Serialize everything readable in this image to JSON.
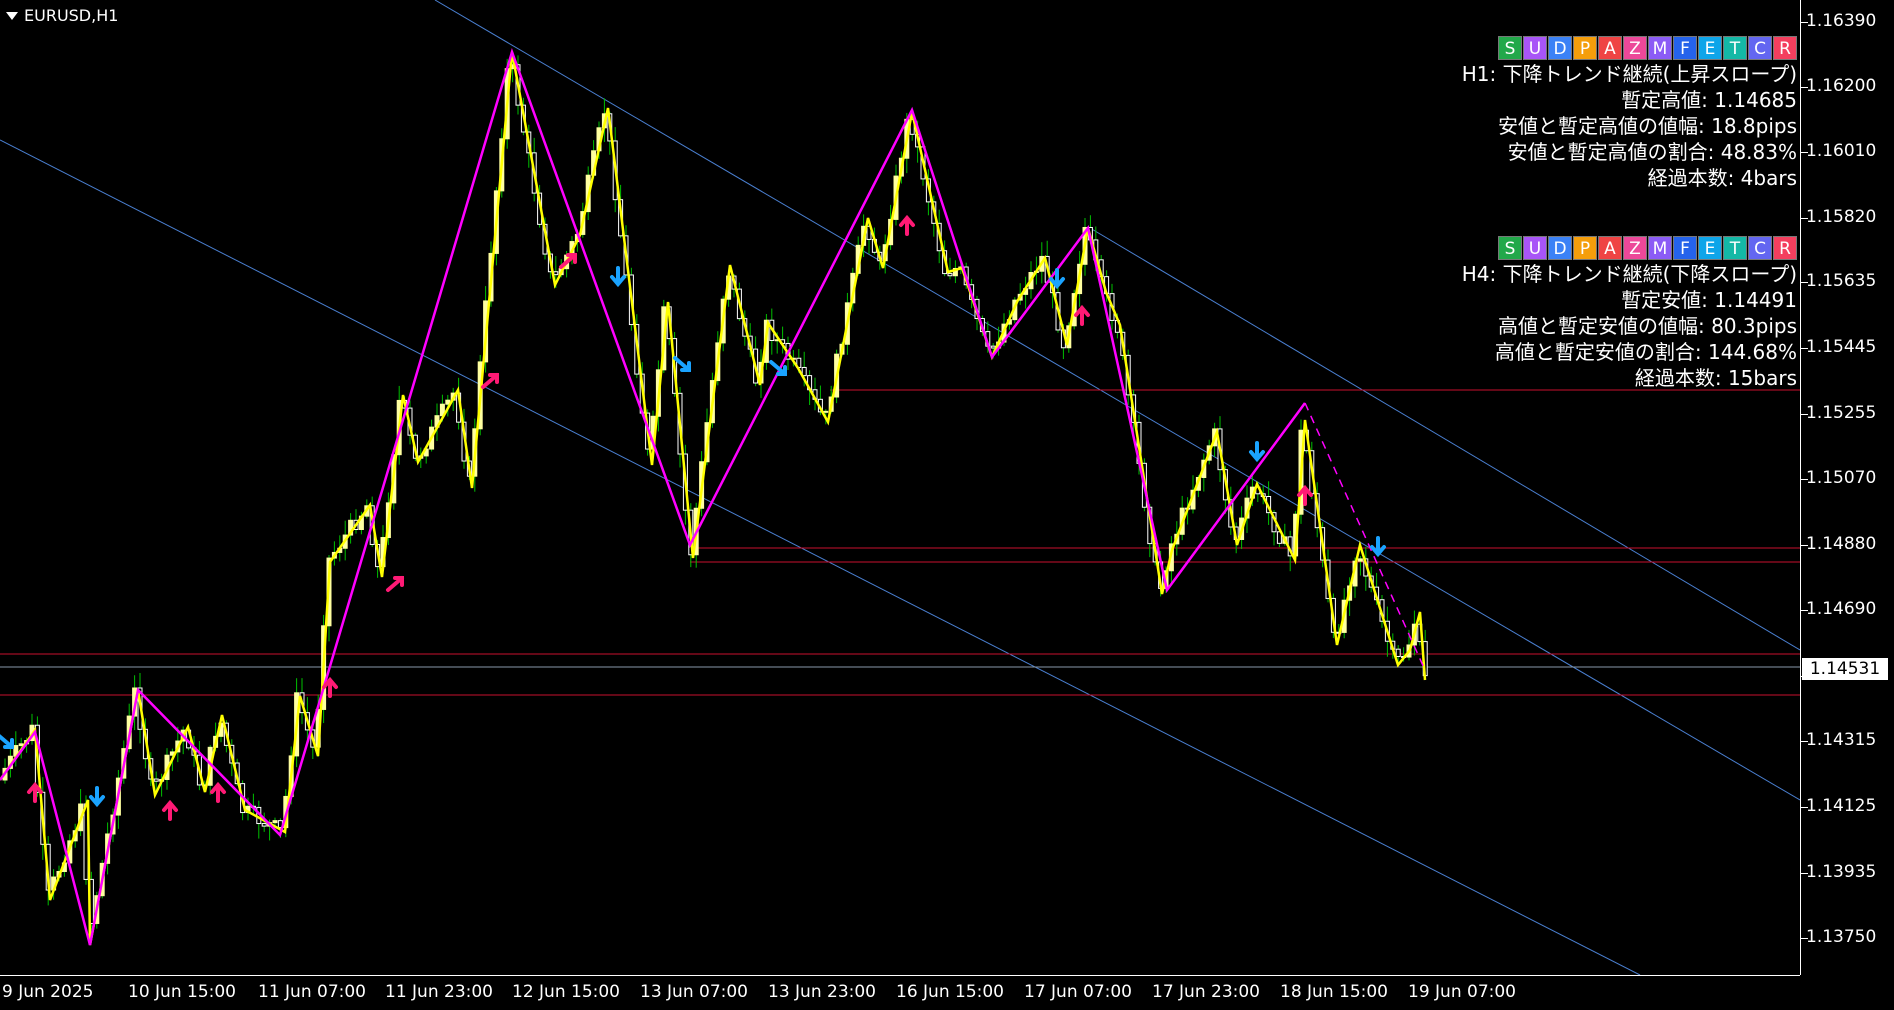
{
  "symbol_label": "EURUSD,H1",
  "panels": [
    {
      "buttons": [
        {
          "label": "S",
          "bg": "#22a84a"
        },
        {
          "label": "U",
          "bg": "#a855f7"
        },
        {
          "label": "D",
          "bg": "#3b82f6"
        },
        {
          "label": "P",
          "bg": "#f59e0b"
        },
        {
          "label": "A",
          "bg": "#ef4444"
        },
        {
          "label": "Z",
          "bg": "#ec4899"
        },
        {
          "label": "M",
          "bg": "#8b5cf6"
        },
        {
          "label": "F",
          "bg": "#2563eb"
        },
        {
          "label": "E",
          "bg": "#0ea5e9"
        },
        {
          "label": "T",
          "bg": "#14b8a6"
        },
        {
          "label": "C",
          "bg": "#6366f1"
        },
        {
          "label": "R",
          "bg": "#f43f5e"
        }
      ],
      "lines": [
        "H1: 下降トレンド継続(上昇スロープ)",
        "暫定高値: 1.14685",
        "安値と暫定高値の値幅: 18.8pips",
        "安値と暫定高値の割合: 48.83%",
        "経過本数: 4bars"
      ]
    },
    {
      "buttons": [
        {
          "label": "S",
          "bg": "#22a84a"
        },
        {
          "label": "U",
          "bg": "#a855f7"
        },
        {
          "label": "D",
          "bg": "#3b82f6"
        },
        {
          "label": "P",
          "bg": "#f59e0b"
        },
        {
          "label": "A",
          "bg": "#ef4444"
        },
        {
          "label": "Z",
          "bg": "#ec4899"
        },
        {
          "label": "M",
          "bg": "#8b5cf6"
        },
        {
          "label": "F",
          "bg": "#2563eb"
        },
        {
          "label": "E",
          "bg": "#0ea5e9"
        },
        {
          "label": "T",
          "bg": "#14b8a6"
        },
        {
          "label": "C",
          "bg": "#6366f1"
        },
        {
          "label": "R",
          "bg": "#f43f5e"
        }
      ],
      "lines": [
        "H4: 下降トレンド継続(下降スロープ)",
        "暫定安値: 1.14491",
        "高値と暫定安値の値幅: 80.3pips",
        "高値と暫定安値の割合: 144.68%",
        "経過本数: 15bars"
      ]
    }
  ],
  "price_ticks": [
    "1.16390",
    "1.16200",
    "1.16010",
    "1.15820",
    "1.15635",
    "1.15445",
    "1.15255",
    "1.15070",
    "1.14880",
    "1.14690",
    "1.14500",
    "1.14315",
    "1.14125",
    "1.13935",
    "1.13750"
  ],
  "current_price": "1.14531",
  "time_ticks": [
    "9 Jun 2025",
    "10 Jun 15:00",
    "11 Jun 07:00",
    "11 Jun 23:00",
    "12 Jun 15:00",
    "13 Jun 07:00",
    "13 Jun 23:00",
    "16 Jun 15:00",
    "17 Jun 07:00",
    "17 Jun 23:00",
    "18 Jun 15:00",
    "19 Jun 07:00"
  ],
  "colors": {
    "background": "#000000",
    "bull_candle": "#ffffa0",
    "bear_candle": "#ffffff",
    "wick": "#00c000",
    "zigzag_h1": "#ffff00",
    "zigzag_h4": "#ff00ff",
    "level_line": "#c8102e",
    "channel_line": "#4a7fd0",
    "arrow_up": "#ff1a75",
    "arrow_down": "#1aa3ff"
  },
  "chart_data": {
    "type": "candlestick",
    "symbol": "EURUSD",
    "timeframe": "H1",
    "ylim": [
      1.137,
      1.1645
    ],
    "zigzag_h1_prices": [
      1.1432,
      1.1441,
      1.1385,
      1.1405,
      1.137,
      1.1452,
      1.141,
      1.144,
      1.142,
      1.1438,
      1.1408,
      1.1449,
      1.1427,
      1.1497,
      1.1482,
      1.153,
      1.1508,
      1.1625,
      1.1562,
      1.1605,
      1.156,
      1.1612,
      1.1535,
      1.1561,
      1.1513,
      1.1565,
      1.149,
      1.157,
      1.1525,
      1.1551,
      1.153,
      1.1541,
      1.1524,
      1.1583,
      1.1572,
      1.161,
      1.158,
      1.1593,
      1.1575,
      1.158,
      1.159,
      1.1545,
      1.1585,
      1.156,
      1.1595,
      1.1475,
      1.1525,
      1.149,
      1.152,
      1.148,
      1.153,
      1.1478,
      1.1487,
      1.1457,
      1.1472
    ],
    "zigzag_h4_prices": [
      1.143,
      1.144,
      1.1372,
      1.1452,
      1.1415,
      1.1628,
      1.1535,
      1.1614,
      1.149,
      1.1612,
      1.1545,
      1.158,
      1.1475,
      1.153,
      1.1455
    ],
    "horizontal_levels": [
      1.1535,
      1.1488,
      1.1485,
      1.1463,
      1.1453,
      1.1445
    ],
    "current_price": 1.14531
  }
}
